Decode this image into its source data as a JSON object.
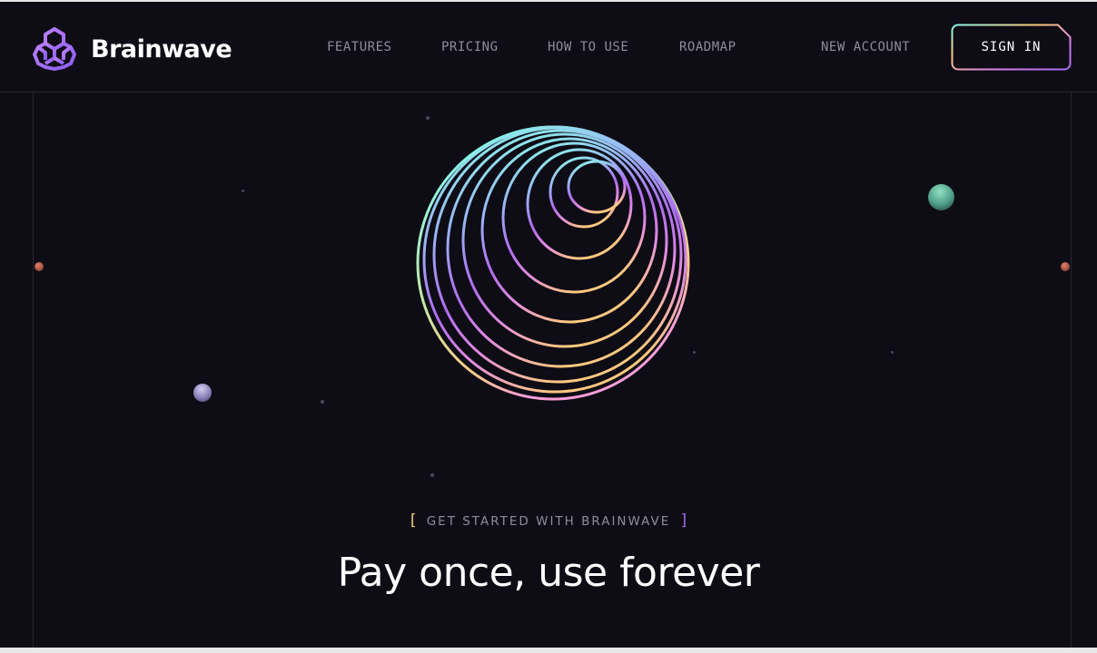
{
  "brand": {
    "name": "Brainwave",
    "logo_icon": "brainwave-logo-icon",
    "accent": "#a86bf0"
  },
  "nav": {
    "items": [
      {
        "label": "FEATURES"
      },
      {
        "label": "PRICING"
      },
      {
        "label": "HOW TO USE"
      },
      {
        "label": "ROADMAP"
      }
    ],
    "new_account": "NEW ACCOUNT",
    "sign_in": "SIGN IN"
  },
  "hero": {
    "eyebrow_open": "[",
    "eyebrow": "GET STARTED WITH BRAINWAVE",
    "eyebrow_close": "]",
    "title": "Pay once, use forever",
    "sphere_icon": "gradient-sphere-graphic"
  },
  "colors": {
    "background": "#0e0c15",
    "gradient_start": "#89f9e8",
    "gradient_mid": "#a86bf0",
    "gradient_end": "#fddd92"
  }
}
